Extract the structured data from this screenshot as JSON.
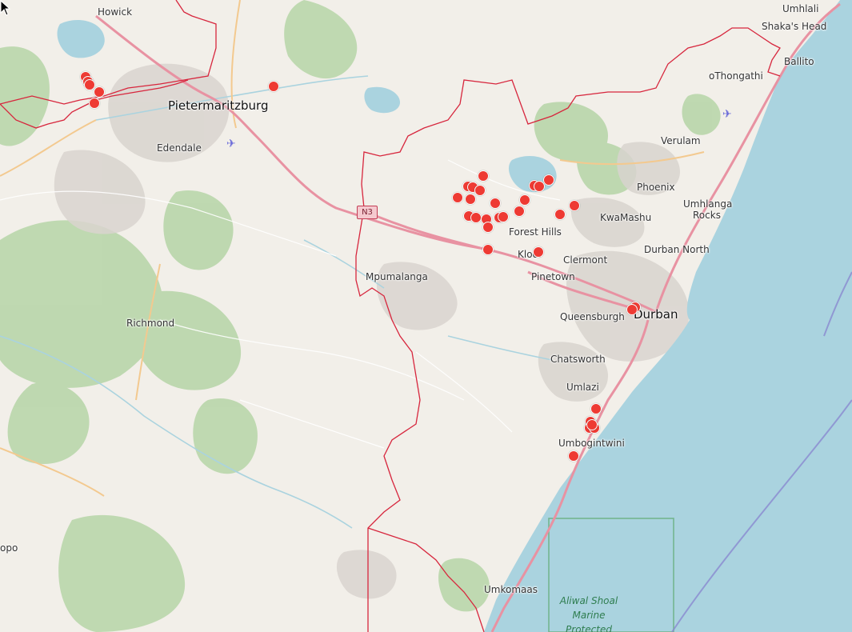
{
  "map": {
    "places": [
      {
        "name": "Howick",
        "kind": "town"
      },
      {
        "name": "Umhlali",
        "kind": "town"
      },
      {
        "name": "Shaka's Head",
        "kind": "town"
      },
      {
        "name": "Ballito",
        "kind": "town"
      },
      {
        "name": "oThongathi",
        "kind": "town"
      },
      {
        "name": "Pietermaritzburg",
        "kind": "city"
      },
      {
        "name": "Edendale",
        "kind": "town"
      },
      {
        "name": "Verulam",
        "kind": "town"
      },
      {
        "name": "Phoenix",
        "kind": "town"
      },
      {
        "name": "Umhlanga",
        "kind": "town"
      },
      {
        "name": "Rocks",
        "kind": "town"
      },
      {
        "name": "KwaMashu",
        "kind": "town"
      },
      {
        "name": "Forest Hills",
        "kind": "town"
      },
      {
        "name": "Durban North",
        "kind": "town"
      },
      {
        "name": "Kloof",
        "kind": "town"
      },
      {
        "name": "Clermont",
        "kind": "town"
      },
      {
        "name": "Mpumalanga",
        "kind": "town"
      },
      {
        "name": "Pinetown",
        "kind": "town"
      },
      {
        "name": "Queensburgh",
        "kind": "town"
      },
      {
        "name": "Durban",
        "kind": "city"
      },
      {
        "name": "Richmond",
        "kind": "town"
      },
      {
        "name": "Chatsworth",
        "kind": "town"
      },
      {
        "name": "Umlazi",
        "kind": "town"
      },
      {
        "name": "Umbogintwini",
        "kind": "town"
      },
      {
        "name": "Umkomaas",
        "kind": "town"
      },
      {
        "name": "opo",
        "kind": "town"
      }
    ],
    "marine_area": [
      "Aliwal Shoal",
      "Marine",
      "Protected"
    ],
    "road_shield": "N3",
    "icons": {
      "airport": "airport-icon",
      "marker": "location-marker-icon"
    },
    "colors": {
      "marker": "#ee3a33",
      "boundary": "#d7263d",
      "sea": "#aad3df",
      "land": "#f2efe9",
      "forest": "#add19e",
      "motorway": "#e892a2"
    },
    "marker_count": 36
  }
}
